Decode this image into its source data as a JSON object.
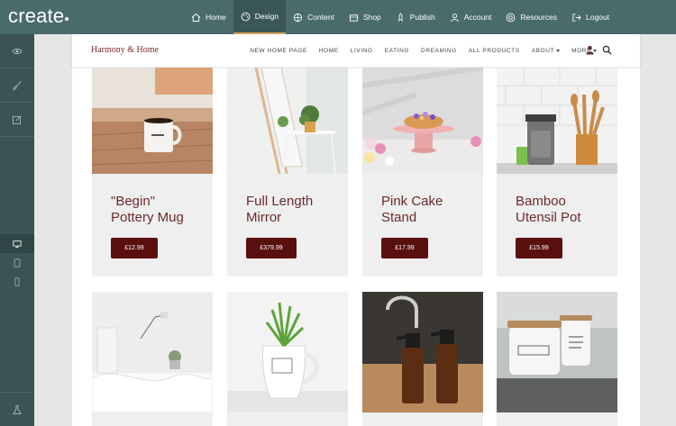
{
  "app": {
    "logo": "create"
  },
  "topnav": [
    {
      "id": "home",
      "label": "Home",
      "icon": "home-icon",
      "active": false
    },
    {
      "id": "design",
      "label": "Design",
      "icon": "palette-icon",
      "active": true
    },
    {
      "id": "content",
      "label": "Content",
      "icon": "content-icon",
      "active": false
    },
    {
      "id": "shop",
      "label": "Shop",
      "icon": "cart-icon",
      "active": false
    },
    {
      "id": "publish",
      "label": "Publish",
      "icon": "rocket-icon",
      "active": false
    },
    {
      "id": "account",
      "label": "Account",
      "icon": "user-icon",
      "active": false
    },
    {
      "id": "resources",
      "label": "Resources",
      "icon": "lifebuoy-icon",
      "active": false
    },
    {
      "id": "logout",
      "label": "Logout",
      "icon": "logout-icon",
      "active": false
    }
  ],
  "site": {
    "brand": "Harmony & Home",
    "nav": [
      "NEW HOME PAGE",
      "HOME",
      "LIVING",
      "EATING",
      "DREAMING",
      "ALL PRODUCTS",
      "ABOUT",
      "MORE"
    ]
  },
  "products": [
    {
      "title_line1": "\"Begin\"",
      "title_line2": "Pottery Mug",
      "price": "£12.99"
    },
    {
      "title_line1": "Full Length",
      "title_line2": "Mirror",
      "price": "£379.99"
    },
    {
      "title_line1": "Pink Cake",
      "title_line2": "Stand",
      "price": "£17.99"
    },
    {
      "title_line1": "Bamboo",
      "title_line2": "Utensil Pot",
      "price": "£15.99"
    }
  ],
  "colors": {
    "topbar": "#4a6b6c",
    "sidebar": "#3b5354",
    "brand": "#7a2a2a",
    "price_button": "#5a0f0f",
    "active_underline": "#d9a35f"
  }
}
